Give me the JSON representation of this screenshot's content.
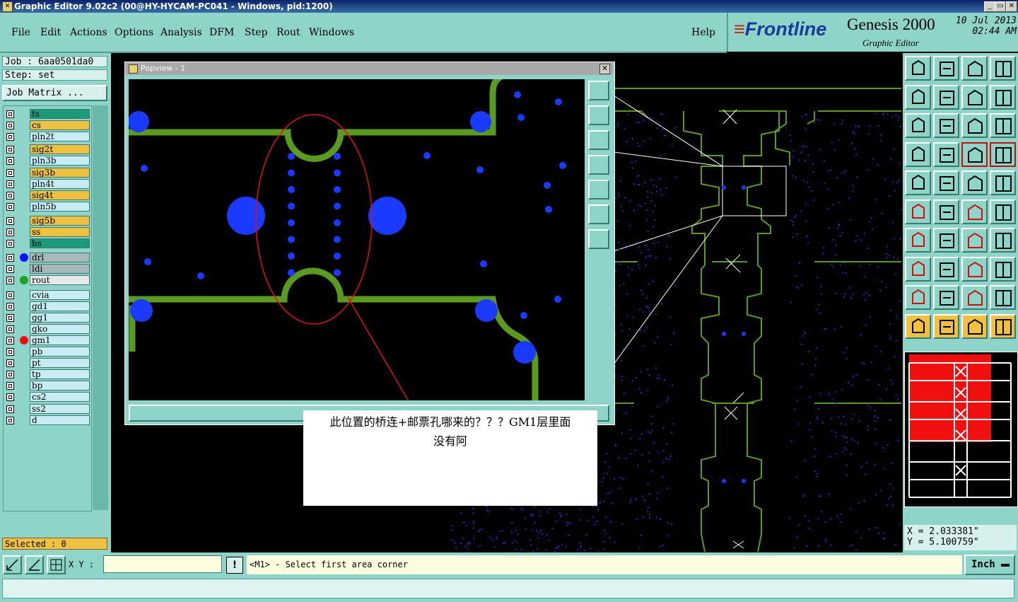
{
  "window": {
    "title": "Graphic Editor 9.02c2 (00@HY-HYCAM-PC041 - Windows, pid:1200)",
    "min": "_",
    "restore": "▭",
    "close": "✕"
  },
  "menu": {
    "file": "File",
    "edit": "Edit",
    "actions": "Actions",
    "options": "Options",
    "analysis": "Analysis",
    "dfm": "DFM",
    "step": "Step",
    "rout": "Rout",
    "windows": "Windows",
    "help": "Help"
  },
  "brand": {
    "logo": "Frontline",
    "product": "Genesis 2000",
    "subtitle": "Graphic Editor",
    "date": "10 Jul 2013",
    "time": "02:44 AM"
  },
  "left": {
    "job": "Job  : 6aa0501da0",
    "step": "Step: set",
    "job_matrix": "Job Matrix ...",
    "selected": "Selected : 0"
  },
  "layers": [
    {
      "name": "ts",
      "color": "#1a9a7a",
      "dot": ""
    },
    {
      "name": "cs",
      "color": "#f0c040",
      "dot": ""
    },
    {
      "name": "pln2t",
      "color": "#c8ecf4",
      "dot": ""
    },
    {
      "name": "sig2t",
      "color": "#f0c040",
      "dot": ""
    },
    {
      "name": "pln3b",
      "color": "#c8ecf4",
      "dot": ""
    },
    {
      "name": "sig3b",
      "color": "#f0c040",
      "dot": ""
    },
    {
      "name": "pln4t",
      "color": "#c8ecf4",
      "dot": ""
    },
    {
      "name": "sig4t",
      "color": "#f0c040",
      "dot": ""
    },
    {
      "name": "pln5b",
      "color": "#c8ecf4",
      "dot": ""
    },
    {
      "name": "sig5b",
      "color": "#f0c040",
      "dot": ""
    },
    {
      "name": "ss",
      "color": "#f0c040",
      "dot": ""
    },
    {
      "name": "bs",
      "color": "#1a9a7a",
      "dot": ""
    },
    {
      "name": "drl",
      "color": "#a8b8bc",
      "dot": "#1010f0"
    },
    {
      "name": "ldi",
      "color": "#a8b8bc",
      "dot": ""
    },
    {
      "name": "rout",
      "color": "#e8e8e8",
      "dot": "#20a020"
    },
    {
      "name": "cvia",
      "color": "#c8ecf4",
      "dot": ""
    },
    {
      "name": "gd1",
      "color": "#c8ecf4",
      "dot": ""
    },
    {
      "name": "gg1",
      "color": "#c8ecf4",
      "dot": ""
    },
    {
      "name": "gko",
      "color": "#c8ecf4",
      "dot": ""
    },
    {
      "name": "gm1",
      "color": "#c8ecf4",
      "dot": "#f01010"
    },
    {
      "name": "pb",
      "color": "#c8ecf4",
      "dot": ""
    },
    {
      "name": "pt",
      "color": "#c8ecf4",
      "dot": ""
    },
    {
      "name": "tp",
      "color": "#c8ecf4",
      "dot": ""
    },
    {
      "name": "bp",
      "color": "#c8ecf4",
      "dot": ""
    },
    {
      "name": "cs2",
      "color": "#c8ecf4",
      "dot": ""
    },
    {
      "name": "ss2",
      "color": "#c8ecf4",
      "dot": ""
    },
    {
      "name": "d",
      "color": "#c8ecf4",
      "dot": ""
    }
  ],
  "popview": {
    "title": "Popview - 1",
    "close": "✕"
  },
  "annotation": {
    "line1": "此位置的桥连+邮票孔哪来的？？？GM1层里面",
    "line2": "没有阿"
  },
  "coords": {
    "x": "X = 2.033381\"",
    "y": "Y = 5.100759\""
  },
  "bottom": {
    "xy_label": "X Y :",
    "xy_value": "",
    "excl": "!",
    "prompt": "<M1> - Select first area corner",
    "unit": "Inch"
  },
  "colors": {
    "panel": "#8fd4c8",
    "trace_green": "#5a9a20",
    "pad_blue": "#1a3aff",
    "highlight_red": "#f01010"
  }
}
